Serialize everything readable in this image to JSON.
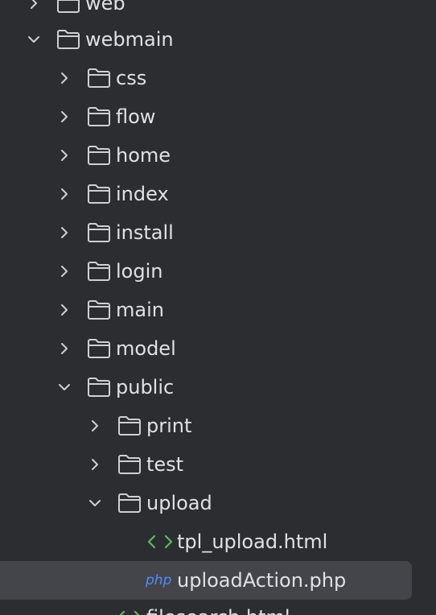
{
  "tree": {
    "items": [
      {
        "label": "web",
        "type": "folder",
        "state": "collapsed"
      },
      {
        "label": "webmain",
        "type": "folder",
        "state": "expanded"
      },
      {
        "label": "css",
        "type": "folder",
        "state": "collapsed"
      },
      {
        "label": "flow",
        "type": "folder",
        "state": "collapsed"
      },
      {
        "label": "home",
        "type": "folder",
        "state": "collapsed"
      },
      {
        "label": "index",
        "type": "folder",
        "state": "collapsed"
      },
      {
        "label": "install",
        "type": "folder",
        "state": "collapsed"
      },
      {
        "label": "login",
        "type": "folder",
        "state": "collapsed"
      },
      {
        "label": "main",
        "type": "folder",
        "state": "collapsed"
      },
      {
        "label": "model",
        "type": "folder",
        "state": "collapsed"
      },
      {
        "label": "public",
        "type": "folder",
        "state": "expanded"
      },
      {
        "label": "print",
        "type": "folder",
        "state": "collapsed"
      },
      {
        "label": "test",
        "type": "folder",
        "state": "collapsed"
      },
      {
        "label": "upload",
        "type": "folder",
        "state": "expanded"
      },
      {
        "label": "tpl_upload.html",
        "type": "html-file",
        "icon": "html-file-icon"
      },
      {
        "label": "uploadAction.php",
        "type": "php-file",
        "icon": "php-file-icon",
        "icon_text": "php",
        "selected": true
      },
      {
        "label": "filesearch.html",
        "type": "html-file",
        "icon": "html-file-icon"
      }
    ]
  },
  "colors": {
    "background": "#2b2d30",
    "selection": "#43454a",
    "text": "#dfe1e5",
    "icon_stroke": "#ced0d6",
    "html_icon": "#5fb85f",
    "php_icon": "#548af7"
  }
}
